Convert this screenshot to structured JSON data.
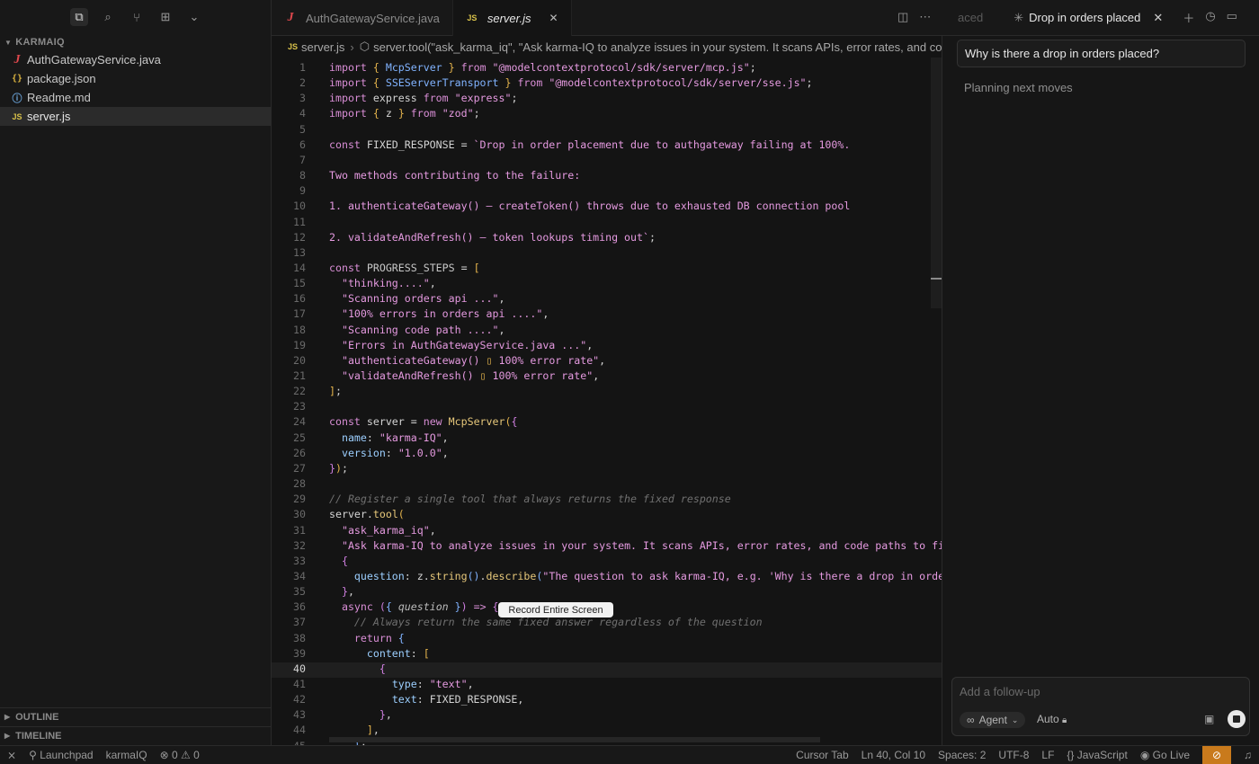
{
  "sidebar": {
    "root": "KARMAIQ",
    "files": [
      {
        "name": "AuthGatewayService.java",
        "icon": "java-icon"
      },
      {
        "name": "package.json",
        "icon": "json-icon"
      },
      {
        "name": "Readme.md",
        "icon": "info-icon"
      },
      {
        "name": "server.js",
        "icon": "js-icon"
      }
    ],
    "outline": "OUTLINE",
    "timeline": "TIMELINE"
  },
  "tabs": [
    {
      "label": "AuthGatewayService.java",
      "icon": "J"
    },
    {
      "label": "server.js",
      "icon": "JS"
    }
  ],
  "breadcrumb": {
    "file": "server.js",
    "symbol": "server.tool(\"ask_karma_iq\", \"Ask karma-IQ to analyze issues in your system. It scans APIs, error rates, and co"
  },
  "editor": {
    "current_line": 40,
    "tooltip": "Record Entire Screen",
    "lines": [
      "1",
      "2",
      "3",
      "4",
      "5",
      "6",
      "7",
      "8",
      "9",
      "10",
      "11",
      "12",
      "13",
      "14",
      "15",
      "16",
      "17",
      "18",
      "19",
      "20",
      "21",
      "22",
      "23",
      "24",
      "25",
      "26",
      "27",
      "28",
      "29",
      "30",
      "31",
      "32",
      "33",
      "34",
      "35",
      "36",
      "37",
      "38",
      "39",
      "40",
      "41",
      "42",
      "43",
      "44",
      "45"
    ]
  },
  "right_panel": {
    "ghost_tab": "aced",
    "tab_title": "Drop in orders placed",
    "question": "Why is there a drop in orders placed?",
    "status": "Planning next moves",
    "composer_placeholder": "Add a follow-up",
    "mode": "Agent",
    "model": "Auto"
  },
  "statusbar": {
    "launchpad": "Launchpad",
    "project": "karmaIQ",
    "errors": "0",
    "warnings": "0",
    "cursor_tab": "Cursor Tab",
    "position": "Ln 40, Col 10",
    "spaces": "Spaces: 2",
    "encoding": "UTF-8",
    "eol": "LF",
    "language": "JavaScript",
    "golive": "Go Live"
  },
  "colors": {
    "accent": "#c97a1c"
  }
}
